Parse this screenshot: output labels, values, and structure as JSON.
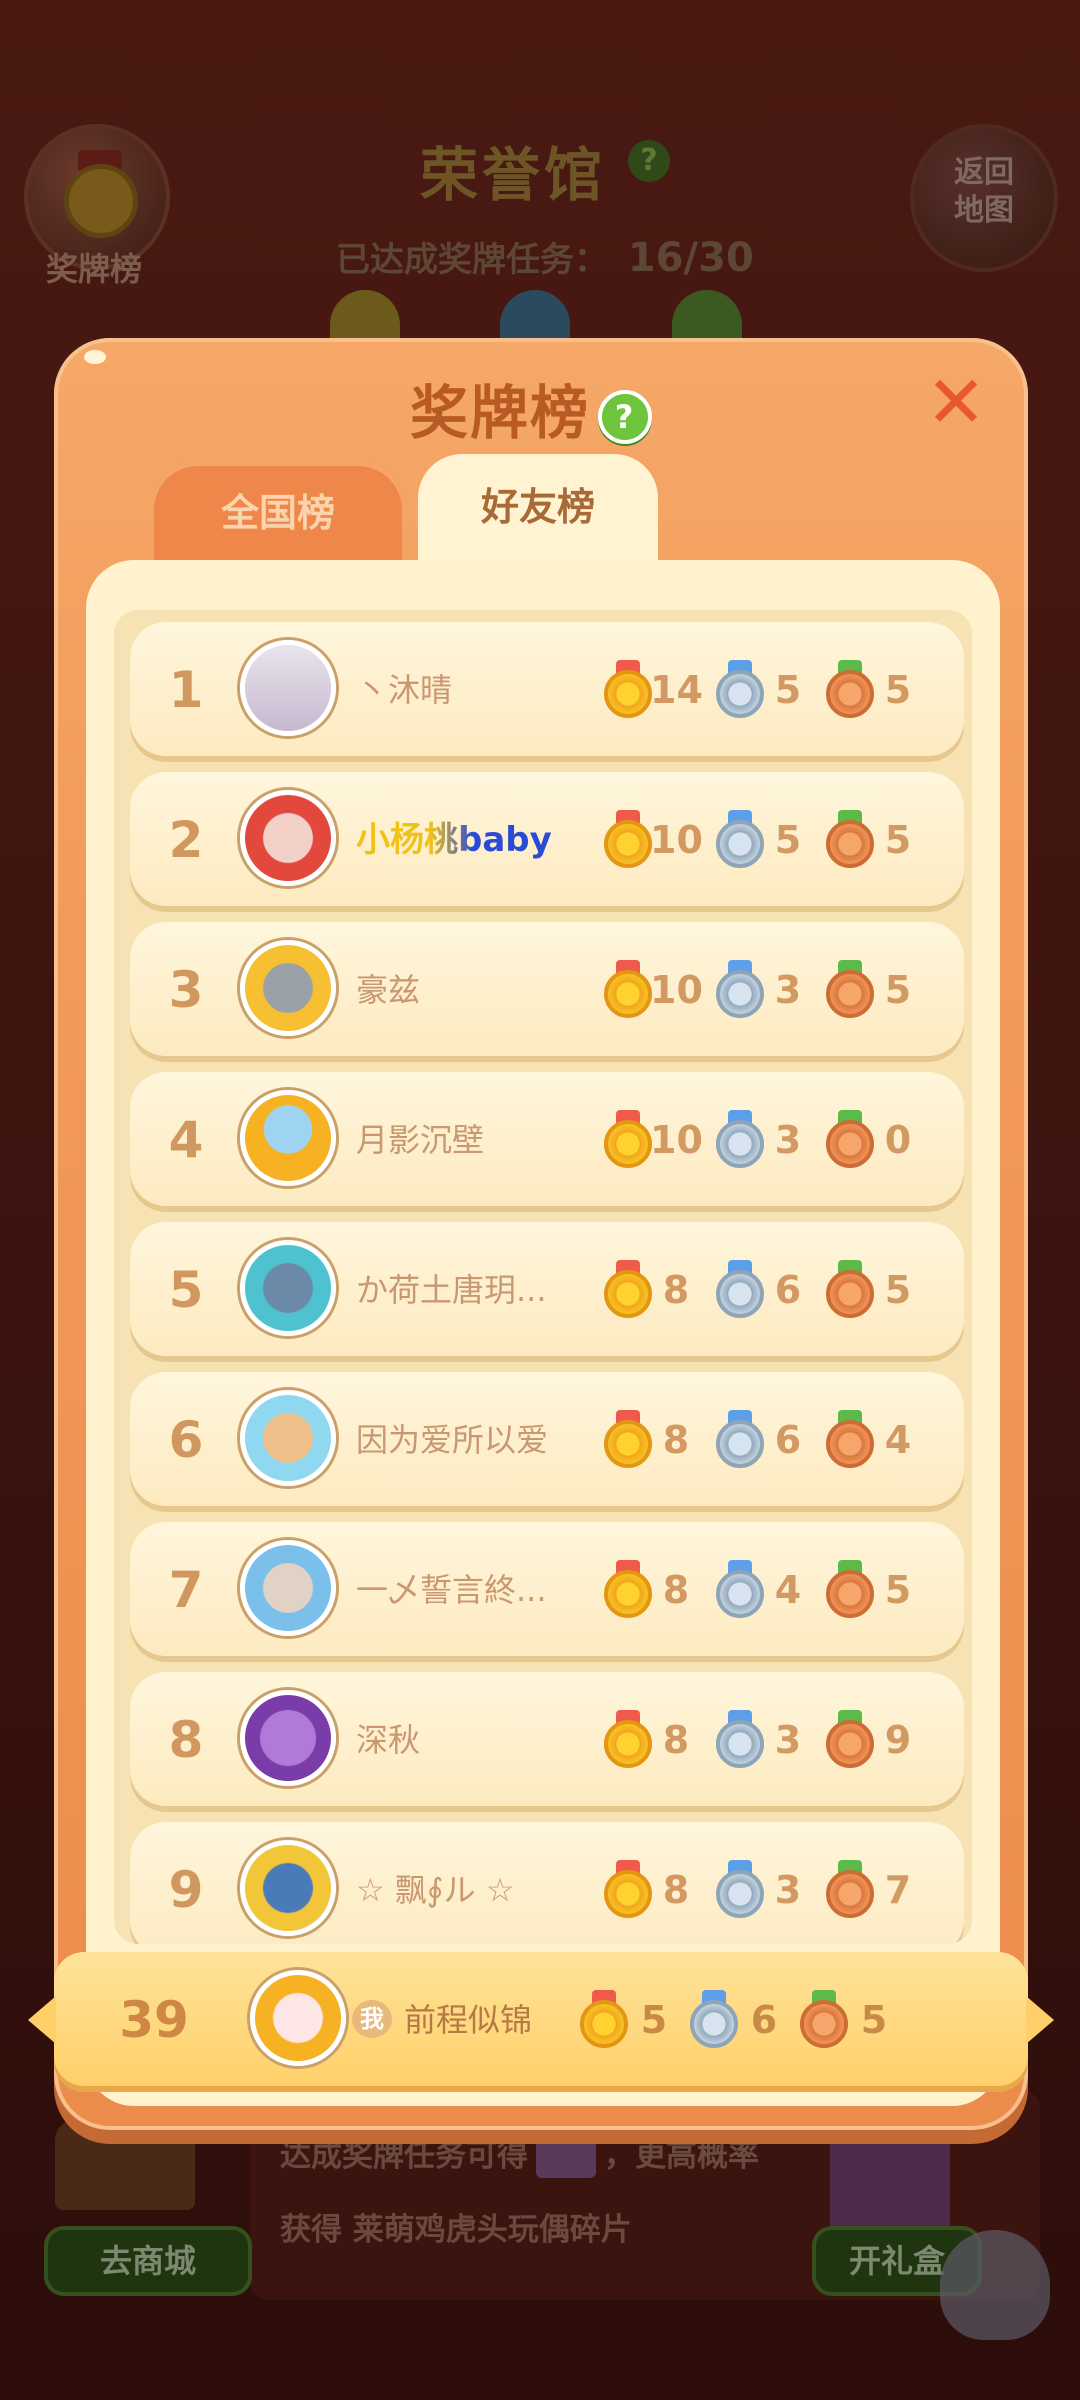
{
  "background": {
    "medal_board_label": "奖牌榜",
    "hall_title": "荣誉馆",
    "hall_help": "?",
    "progress_label": "已达成奖牌任务：",
    "progress_value": "16/30",
    "return_label_line1": "返回",
    "return_label_line2": "地图",
    "bottom_text_line1": "达成奖牌任务可得",
    "bottom_text_line1_tail": "，更高概率",
    "bottom_text_line2": "获得 莱萌鸡虎头玩偶碎片",
    "shop_button": "去商城",
    "open_box_button": "开礼盒"
  },
  "modal": {
    "title": "奖牌榜",
    "help": "?",
    "close": "✕",
    "tabs": [
      {
        "label": "全国榜",
        "selected": false
      },
      {
        "label": "好友榜",
        "selected": true
      }
    ]
  },
  "colors": {
    "modal_orange": "#f29b5c",
    "panel_cream": "#fff2cc",
    "gold": "#f7c225",
    "silver": "#c3d2df",
    "bronze": "#f19459",
    "name_highlight_gold": "#f0c218",
    "name_highlight_blue": "#2a4bd6"
  },
  "rows": [
    {
      "rank": "1",
      "name": "丶沐晴",
      "gold": "14",
      "silver": "5",
      "bronze": "5",
      "avatar": "photo-woman"
    },
    {
      "rank": "2",
      "name": "小杨桃baby",
      "gold": "10",
      "silver": "5",
      "bronze": "5",
      "avatar": "cat-frame"
    },
    {
      "rank": "3",
      "name": "豪兹",
      "gold": "10",
      "silver": "3",
      "bronze": "5",
      "avatar": "chick-frame"
    },
    {
      "rank": "4",
      "name": "月影沉壁",
      "gold": "10",
      "silver": "3",
      "bronze": "0",
      "avatar": "chick-4000"
    },
    {
      "rank": "5",
      "name": "か荷土唐玥...",
      "gold": "8",
      "silver": "6",
      "bronze": "5",
      "avatar": "koi-frame"
    },
    {
      "rank": "6",
      "name": "因为爱所以爱",
      "gold": "8",
      "silver": "6",
      "bronze": "4",
      "avatar": "gemini-boy"
    },
    {
      "rank": "7",
      "name": "一乄誓言終...",
      "gold": "8",
      "silver": "4",
      "bronze": "5",
      "avatar": "blue-frame"
    },
    {
      "rank": "8",
      "name": "深秋",
      "gold": "8",
      "silver": "3",
      "bronze": "9",
      "avatar": "purple-monster"
    },
    {
      "rank": "9",
      "name": "☆ 飘∮ル ☆",
      "gold": "8",
      "silver": "3",
      "bronze": "7",
      "avatar": "crown-frame"
    }
  ],
  "me": {
    "rank": "39",
    "badge": "我",
    "name": "前程似锦",
    "gold": "5",
    "silver": "6",
    "bronze": "5",
    "avatar": "cartoon-girl"
  }
}
